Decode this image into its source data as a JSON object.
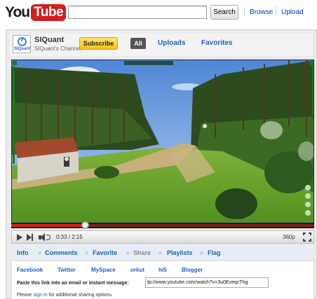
{
  "header": {
    "logo": {
      "you": "You",
      "tube": "Tube"
    },
    "search": {
      "value": "",
      "placeholder": "",
      "button_label": "Search"
    },
    "links": [
      "Browse",
      "Upload"
    ]
  },
  "channel": {
    "avatar_text": "SIQuant",
    "name": "SIQuant",
    "subtitle": "SIQuant's Channel",
    "subscribe_label": "Subscribe",
    "tabs": [
      {
        "label": "All",
        "selected": true
      },
      {
        "label": "Uploads",
        "selected": false
      },
      {
        "label": "Favorites",
        "selected": false
      }
    ]
  },
  "player": {
    "time_current": "0:33",
    "time_total": "2:15",
    "time_display": "0:33 / 2:15",
    "quality": "360p",
    "progress_fraction": 0.244,
    "loaded_fraction": 1.0
  },
  "actions": [
    {
      "label": "Info",
      "active": false
    },
    {
      "label": "Comments",
      "active": false
    },
    {
      "label": "Favorite",
      "active": false
    },
    {
      "label": "Share",
      "active": true
    },
    {
      "label": "Playlists",
      "active": false
    },
    {
      "label": "Flag",
      "active": false
    }
  ],
  "share": {
    "sites": [
      "Facebook",
      "Twitter",
      "MySpace",
      "orkut",
      "hi5",
      "Blogger"
    ],
    "paste_label": "Paste this link into an email or instant message:",
    "url": "tp://www.youtube.com/watch?v=3u0EceqcThg",
    "sign_in_prefix": "Please ",
    "sign_in_link": "sign in",
    "sign_in_suffix": " for additional sharing options."
  },
  "colors": {
    "brand_red": "#d41c1c",
    "link_blue": "#1c62b9",
    "subscribe_yellow": "#f4c21a"
  }
}
